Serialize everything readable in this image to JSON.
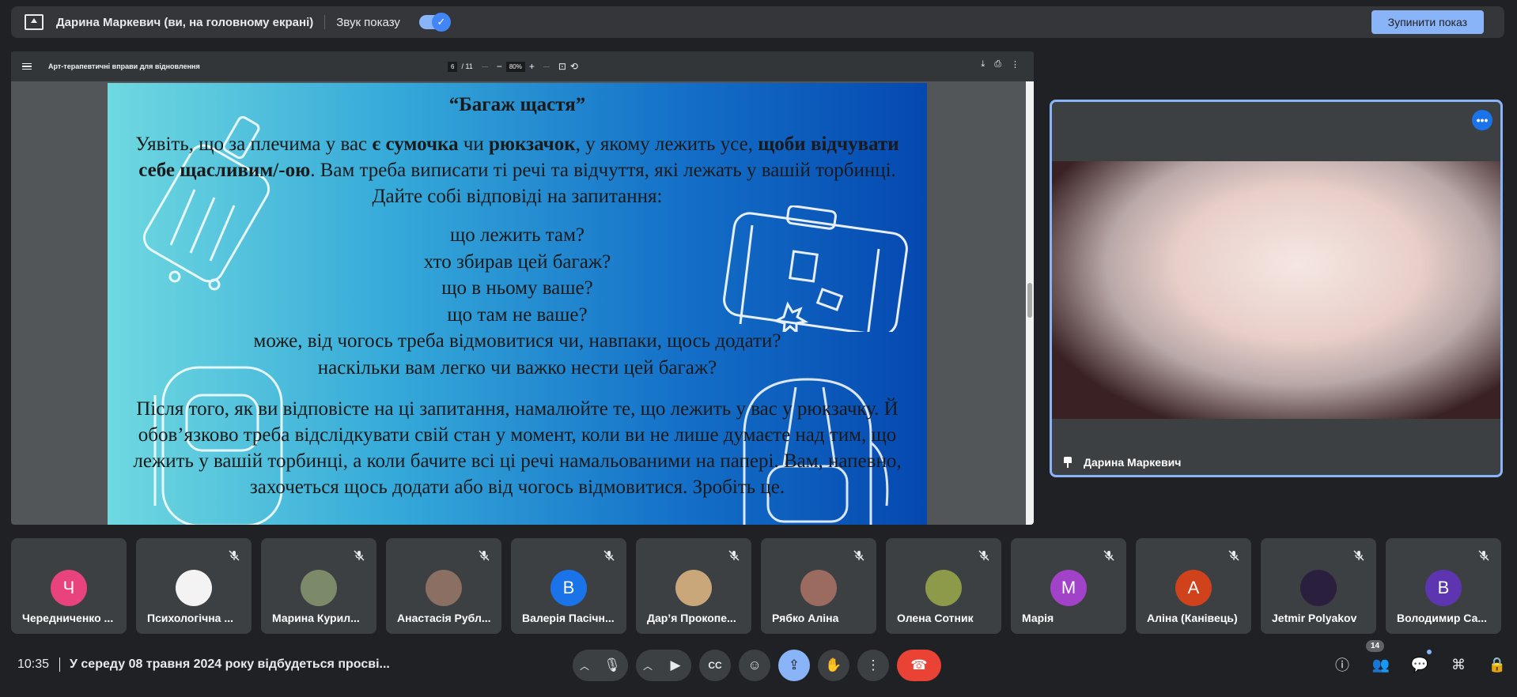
{
  "share_bar": {
    "presenter_text": "Дарина Маркевич (ви, на головному екрані)",
    "sound_label": "Звук показу",
    "sound_on": true,
    "stop_button": "Зупинити показ"
  },
  "pdf": {
    "title": "Арт-терапевтичні вправи для відновлення",
    "page_current": "6",
    "page_total": "/ 11",
    "zoom": "80%",
    "zoom_minus": "−",
    "zoom_plus": "+"
  },
  "slide": {
    "title": "“Багаж щастя”",
    "intro_1": "Уявіть, що за плечима у вас ",
    "intro_b1": "є сумочка",
    "intro_2": " чи ",
    "intro_b2": "рюкзачок",
    "intro_3": ", у якому лежить усе, ",
    "intro_b3": "щоби відчувати себе щасливим/-ою",
    "intro_4": ". Вам треба виписати ті речі та відчуття, які лежать у вашій торбинці. Дайте собі відповіді на запитання:",
    "questions": [
      "що лежить там?",
      "хто збирав цей багаж?",
      "що в ньому ваше?",
      "що там не ваше?",
      "може, від чогось треба відмовитися чи, навпаки, щось додати?",
      "наскільки вам легко чи важко нести цей багаж?"
    ],
    "outro": "Після того, як ви відповісте на ці запитання, намалюйте те, що лежить у вас у рюкзачку. Й обов’язково треба відслідкувати свій стан у момент, коли ви не лише думаєте над тим, що лежить у вашій торбинці, а коли бачите всі ці речі намальованими на папері. Вам, напевно, захочеться щось додати або від чогось відмовитися. Зробіть це."
  },
  "self_video": {
    "name": "Дарина Маркевич"
  },
  "participants": [
    {
      "name": "Чередниченко ...",
      "initial": "Ч",
      "color": "#e8437c",
      "muted": false
    },
    {
      "name": "Психологічна ...",
      "initial": "",
      "color": "#f3f3f3",
      "muted": true
    },
    {
      "name": "Марина Курил...",
      "initial": "",
      "color": "#7d8a6a",
      "muted": true
    },
    {
      "name": "Анастасія Рубл...",
      "initial": "",
      "color": "#8a6f62",
      "muted": true
    },
    {
      "name": "Валерія Пасічн...",
      "initial": "В",
      "color": "#1a73e8",
      "muted": true
    },
    {
      "name": "Дар’я Прокопе...",
      "initial": "",
      "color": "#c9a77a",
      "muted": true
    },
    {
      "name": "Рябко Аліна",
      "initial": "",
      "color": "#9a6b5e",
      "muted": true
    },
    {
      "name": "Олена Сотник",
      "initial": "",
      "color": "#8c9a4a",
      "muted": true
    },
    {
      "name": "Марія",
      "initial": "М",
      "color": "#a142c9",
      "muted": true
    },
    {
      "name": "Аліна (Канівець)",
      "initial": "А",
      "color": "#d0421b",
      "muted": true
    },
    {
      "name": "Jetmir Polyakov",
      "initial": "",
      "color": "#2a1f3d",
      "muted": true
    },
    {
      "name": "Володимир Са...",
      "initial": "В",
      "color": "#5e35b1",
      "muted": true
    }
  ],
  "bottom": {
    "time": "10:35",
    "meeting_title": "У середу 08 травня 2024 року відбудеться просві...",
    "people_count": "14"
  }
}
